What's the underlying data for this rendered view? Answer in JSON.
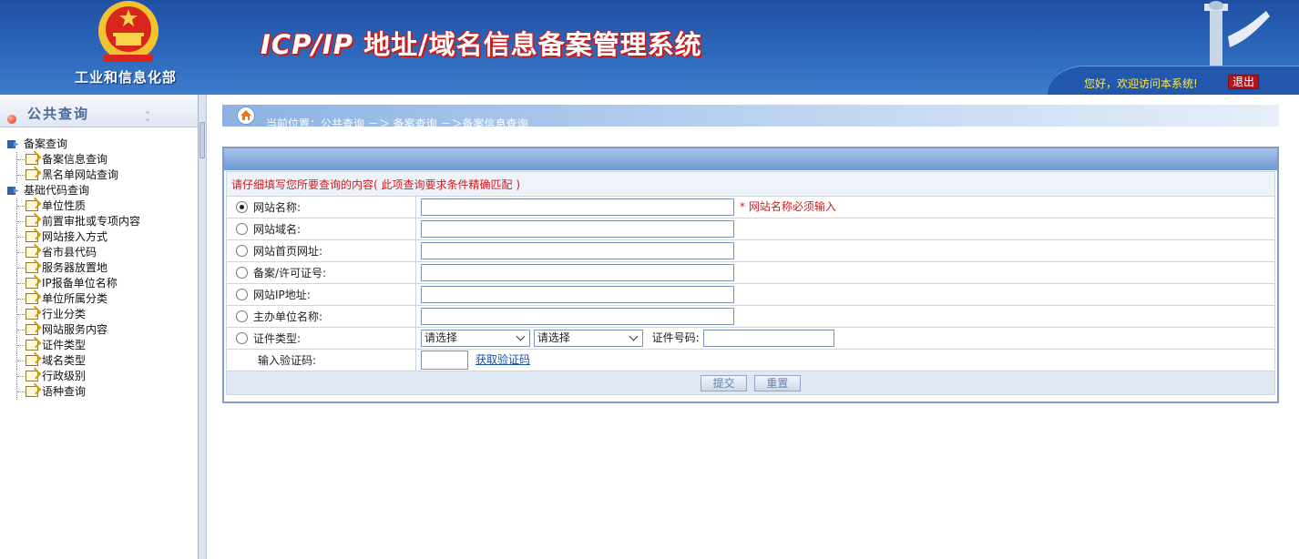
{
  "header": {
    "ministry_name": "工业和信息化部",
    "system_title_latin": "ICP/IP",
    "system_title_cn": " 地址/域名信息备案管理系统",
    "welcome": "您好，欢迎访问本系统!",
    "logout": "退出"
  },
  "sidebar": {
    "title": "公共查询",
    "groups": [
      {
        "label": "备案查询",
        "items": [
          "备案信息查询",
          "黑名单网站查询"
        ]
      },
      {
        "label": "基础代码查询",
        "items": [
          "单位性质",
          "前置审批或专项内容",
          "网站接入方式",
          "省市县代码",
          "服务器放置地",
          "IP报备单位名称",
          "单位所属分类",
          "行业分类",
          "网站服务内容",
          "证件类型",
          "域名类型",
          "行政级别",
          "语种查询"
        ]
      }
    ]
  },
  "breadcrumb": "当前位置：公共查询 －＞ 备案查询 －＞备案信息查询",
  "form": {
    "hint": "请仔细填写您所要查询的内容( 此项查询要求条件精确匹配 )",
    "fields": [
      {
        "label": "网站名称:",
        "checked": true,
        "required_note": "* 网站名称必须输入"
      },
      {
        "label": "网站域名:"
      },
      {
        "label": "网站首页网址:"
      },
      {
        "label": "备案/许可证号:"
      },
      {
        "label": "网站IP地址:"
      },
      {
        "label": "主办单位名称:"
      }
    ],
    "cert_type_label": "证件类型:",
    "select_placeholder_1": "请选择",
    "select_placeholder_2": "请选择",
    "cert_number_label": "证件号码:",
    "captcha_label": "输入验证码:",
    "captcha_link": "获取验证码",
    "submit": "提交",
    "reset": "重置"
  },
  "colors": {
    "header_blue": "#2a63b8",
    "required_red": "#d21a1a",
    "logout_red": "#b5121b",
    "welcome_yellow": "#ffe94a"
  }
}
